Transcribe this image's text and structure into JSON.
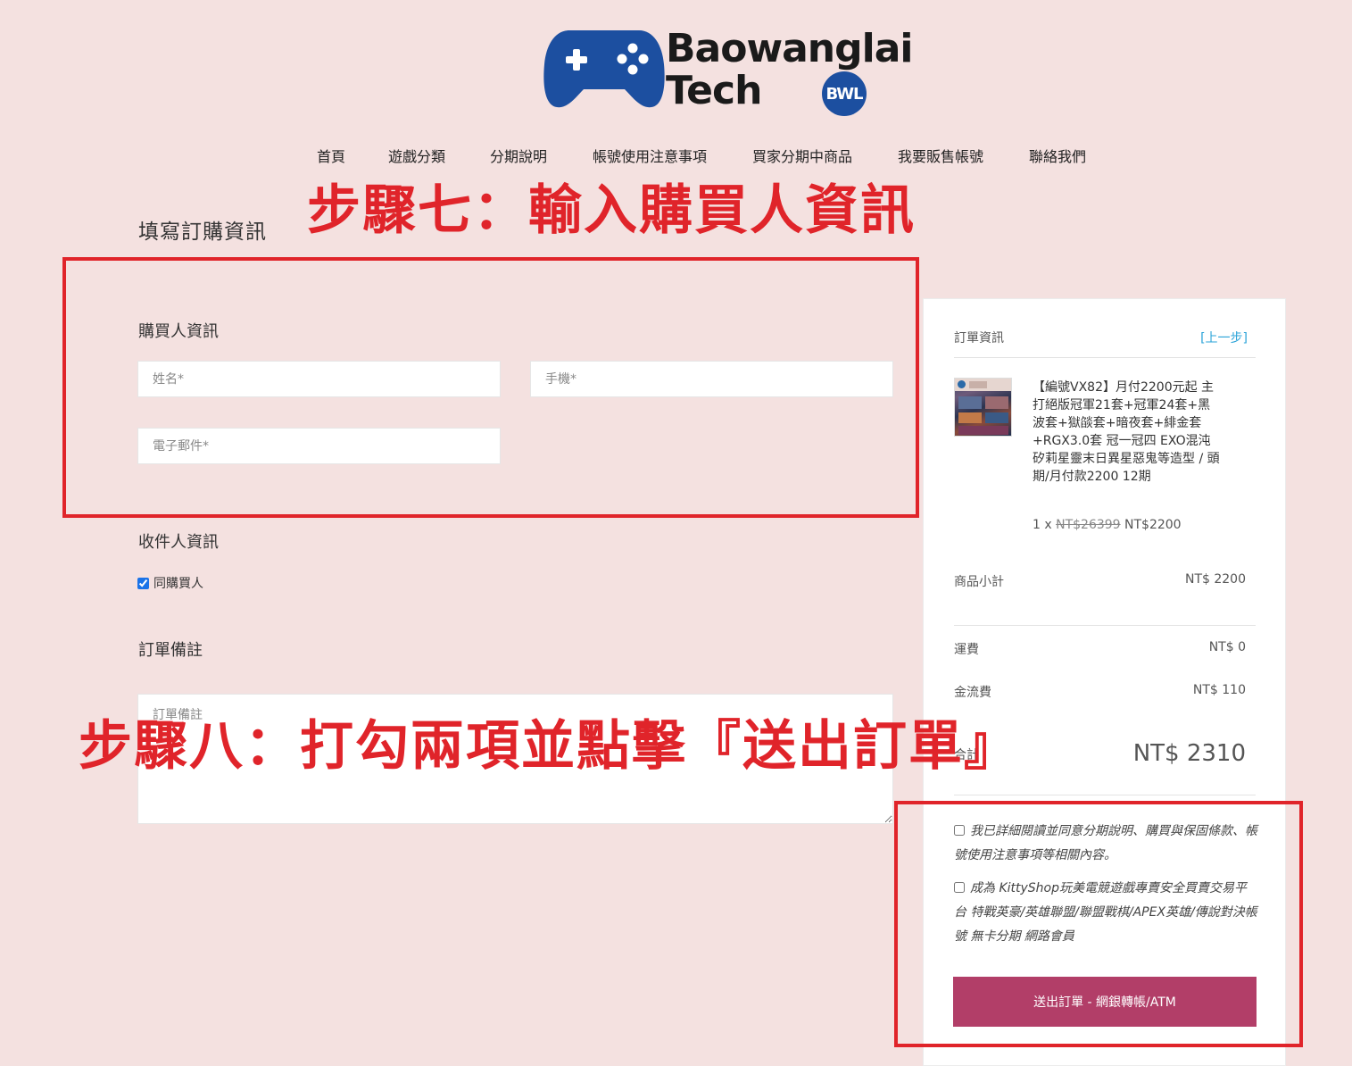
{
  "brand": {
    "line1": "Baowanglai",
    "line2": "Tech",
    "badge": "BWL",
    "colors": {
      "pad": "#1c4fa0",
      "badge": "#1c4fa0"
    }
  },
  "nav": [
    "首頁",
    "遊戲分類",
    "分期說明",
    "帳號使用注意事項",
    "買家分期中商品",
    "我要販售帳號",
    "聯絡我們"
  ],
  "annotations": {
    "step7": "步驟七：輸入購買人資訊",
    "step8": "步驟八：打勾兩項並點擊『送出訂單』",
    "color": "#e0242a"
  },
  "form": {
    "page_title": "填寫訂購資訊",
    "buyer_title": "購買人資訊",
    "name_placeholder": "姓名*",
    "phone_placeholder": "手機*",
    "email_placeholder": "電子郵件*",
    "recipient_title": "收件人資訊",
    "same_as_buyer": "同購買人",
    "note_title": "訂單備註",
    "note_placeholder": "訂單備註"
  },
  "order": {
    "title": "訂單資訊",
    "back": "[上一步]",
    "product_name": "【編號VX82】月付2200元起 主打絕版冠軍21套+冠軍24套+黑波套+獄燄套+暗夜套+緋金套+RGX3.0套 冠一冠四 EXO混沌矽莉星靈末日異星惡鬼等造型 / 頭期/月付款2200 12期",
    "qty": "1 x",
    "orig_price": "NT$26399",
    "price": "NT$2200",
    "subtotal_label": "商品小計",
    "subtotal": "NT$ 2200",
    "shipping_label": "運費",
    "shipping": "NT$ 0",
    "fee_label": "金流費",
    "fee": "NT$ 110",
    "total_label": "合計",
    "total": "NT$ 2310",
    "term1": "我已詳細閱讀並同意分期說明、購買與保固條款、帳號使用注意事項等相關內容。",
    "term2": "成為 KittyShop玩美電競遊戲專賣安全買賣交易平台 特戰英豪/英雄聯盟/聯盟戰棋/APEX英雄/傳說對決帳號 無卡分期 網路會員",
    "submit": "送出訂單 - 網銀轉帳/ATM",
    "button_color": "#b23e68"
  }
}
